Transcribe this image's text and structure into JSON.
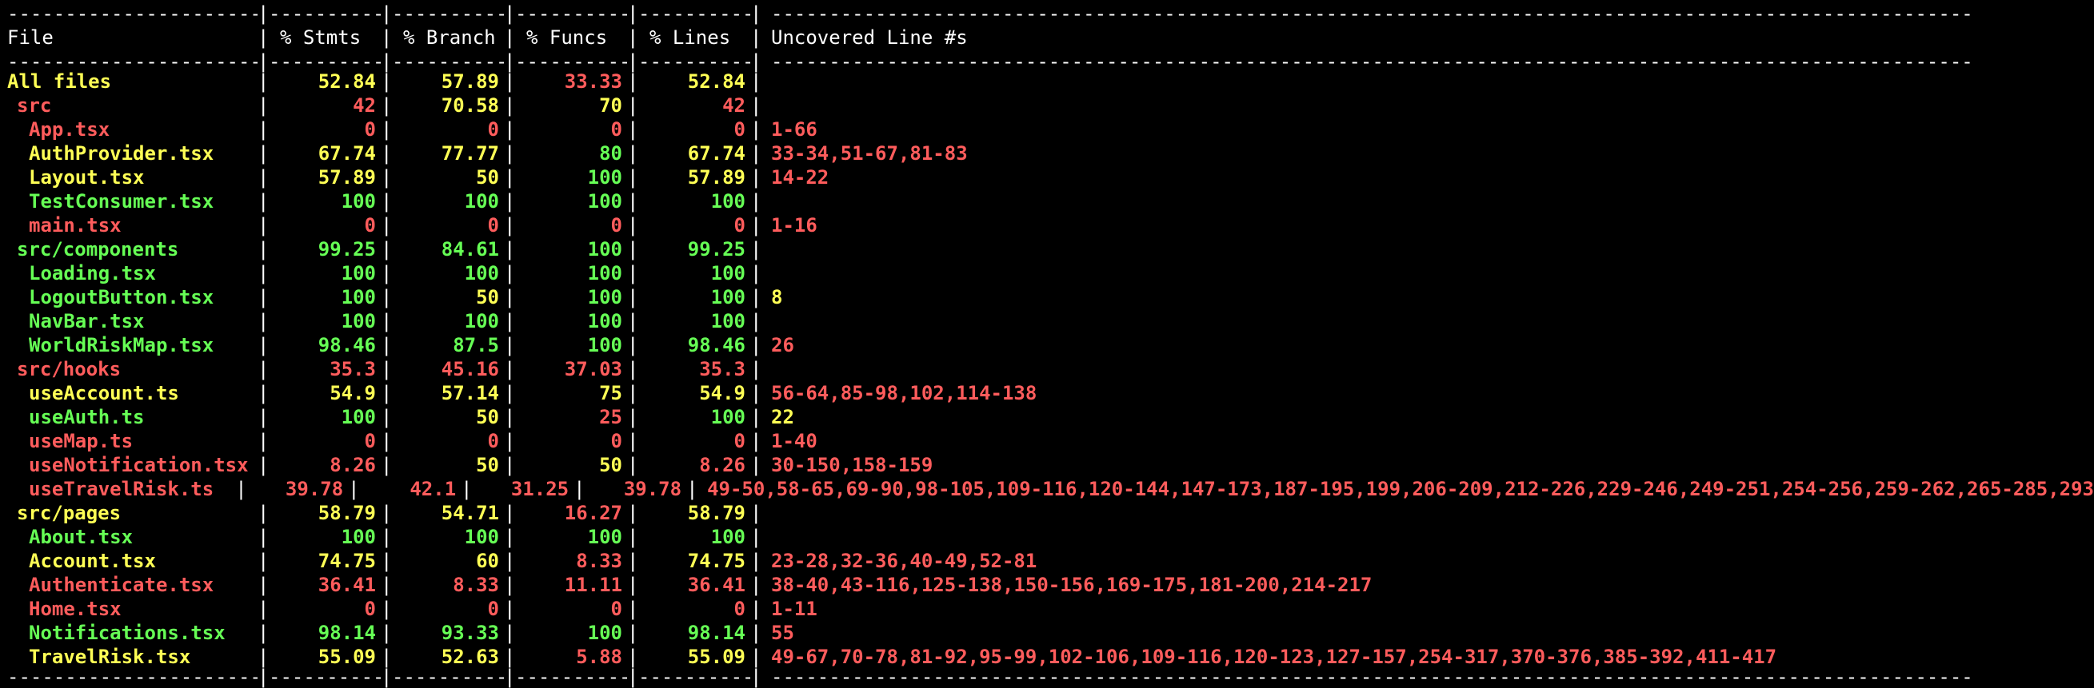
{
  "header": {
    "file": "File",
    "stmts": "% Stmts",
    "branch": "% Branch",
    "funcs": "% Funcs",
    "lines": "% Lines",
    "uncovered": "Uncovered Line #s"
  },
  "colors": {
    "high": "#66ff55",
    "medium": "#ffff55",
    "low": "#ff5c5c",
    "background": "#000000",
    "text": "#ffffff"
  },
  "rows": [
    {
      "file": "All files",
      "stmts": "52.84",
      "branch": "57.89",
      "funcs": "33.33",
      "lines": "52.84",
      "uncovered": "",
      "level": 0,
      "c": {
        "file": "medium",
        "stmts": "medium",
        "branch": "medium",
        "funcs": "low",
        "lines": "medium",
        "unc": "medium"
      }
    },
    {
      "file": "src",
      "stmts": "42",
      "branch": "70.58",
      "funcs": "70",
      "lines": "42",
      "uncovered": "",
      "level": 1,
      "c": {
        "file": "low",
        "stmts": "low",
        "branch": "medium",
        "funcs": "medium",
        "lines": "low",
        "unc": "low"
      }
    },
    {
      "file": "App.tsx",
      "stmts": "0",
      "branch": "0",
      "funcs": "0",
      "lines": "0",
      "uncovered": "1-66",
      "level": 2,
      "c": {
        "file": "low",
        "stmts": "low",
        "branch": "low",
        "funcs": "low",
        "lines": "low",
        "unc": "low"
      }
    },
    {
      "file": "AuthProvider.tsx",
      "stmts": "67.74",
      "branch": "77.77",
      "funcs": "80",
      "lines": "67.74",
      "uncovered": "33-34,51-67,81-83",
      "level": 2,
      "c": {
        "file": "medium",
        "stmts": "medium",
        "branch": "medium",
        "funcs": "good",
        "lines": "medium",
        "unc": "low"
      }
    },
    {
      "file": "Layout.tsx",
      "stmts": "57.89",
      "branch": "50",
      "funcs": "100",
      "lines": "57.89",
      "uncovered": "14-22",
      "level": 2,
      "c": {
        "file": "medium",
        "stmts": "medium",
        "branch": "medium",
        "funcs": "good",
        "lines": "medium",
        "unc": "low"
      }
    },
    {
      "file": "TestConsumer.tsx",
      "stmts": "100",
      "branch": "100",
      "funcs": "100",
      "lines": "100",
      "uncovered": "",
      "level": 2,
      "c": {
        "file": "good",
        "stmts": "good",
        "branch": "good",
        "funcs": "good",
        "lines": "good",
        "unc": "good"
      }
    },
    {
      "file": "main.tsx",
      "stmts": "0",
      "branch": "0",
      "funcs": "0",
      "lines": "0",
      "uncovered": "1-16",
      "level": 2,
      "c": {
        "file": "low",
        "stmts": "low",
        "branch": "low",
        "funcs": "low",
        "lines": "low",
        "unc": "low"
      }
    },
    {
      "file": "src/components",
      "stmts": "99.25",
      "branch": "84.61",
      "funcs": "100",
      "lines": "99.25",
      "uncovered": "",
      "level": 1,
      "c": {
        "file": "good",
        "stmts": "good",
        "branch": "good",
        "funcs": "good",
        "lines": "good",
        "unc": "good"
      }
    },
    {
      "file": "Loading.tsx",
      "stmts": "100",
      "branch": "100",
      "funcs": "100",
      "lines": "100",
      "uncovered": "",
      "level": 2,
      "c": {
        "file": "good",
        "stmts": "good",
        "branch": "good",
        "funcs": "good",
        "lines": "good",
        "unc": "good"
      }
    },
    {
      "file": "LogoutButton.tsx",
      "stmts": "100",
      "branch": "50",
      "funcs": "100",
      "lines": "100",
      "uncovered": "8",
      "level": 2,
      "c": {
        "file": "good",
        "stmts": "good",
        "branch": "medium",
        "funcs": "good",
        "lines": "good",
        "unc": "medium"
      }
    },
    {
      "file": "NavBar.tsx",
      "stmts": "100",
      "branch": "100",
      "funcs": "100",
      "lines": "100",
      "uncovered": "",
      "level": 2,
      "c": {
        "file": "good",
        "stmts": "good",
        "branch": "good",
        "funcs": "good",
        "lines": "good",
        "unc": "good"
      }
    },
    {
      "file": "WorldRiskMap.tsx",
      "stmts": "98.46",
      "branch": "87.5",
      "funcs": "100",
      "lines": "98.46",
      "uncovered": "26",
      "level": 2,
      "c": {
        "file": "good",
        "stmts": "good",
        "branch": "good",
        "funcs": "good",
        "lines": "good",
        "unc": "low"
      }
    },
    {
      "file": "src/hooks",
      "stmts": "35.3",
      "branch": "45.16",
      "funcs": "37.03",
      "lines": "35.3",
      "uncovered": "",
      "level": 1,
      "c": {
        "file": "low",
        "stmts": "low",
        "branch": "low",
        "funcs": "low",
        "lines": "low",
        "unc": "low"
      }
    },
    {
      "file": "useAccount.ts",
      "stmts": "54.9",
      "branch": "57.14",
      "funcs": "75",
      "lines": "54.9",
      "uncovered": "56-64,85-98,102,114-138",
      "level": 2,
      "c": {
        "file": "medium",
        "stmts": "medium",
        "branch": "medium",
        "funcs": "medium",
        "lines": "medium",
        "unc": "low"
      }
    },
    {
      "file": "useAuth.ts",
      "stmts": "100",
      "branch": "50",
      "funcs": "25",
      "lines": "100",
      "uncovered": "22",
      "level": 2,
      "c": {
        "file": "good",
        "stmts": "good",
        "branch": "medium",
        "funcs": "low",
        "lines": "good",
        "unc": "medium"
      }
    },
    {
      "file": "useMap.ts",
      "stmts": "0",
      "branch": "0",
      "funcs": "0",
      "lines": "0",
      "uncovered": "1-40",
      "level": 2,
      "c": {
        "file": "low",
        "stmts": "low",
        "branch": "low",
        "funcs": "low",
        "lines": "low",
        "unc": "low"
      }
    },
    {
      "file": "useNotification.tsx",
      "stmts": "8.26",
      "branch": "50",
      "funcs": "50",
      "lines": "8.26",
      "uncovered": "30-150,158-159",
      "level": 2,
      "c": {
        "file": "low",
        "stmts": "low",
        "branch": "medium",
        "funcs": "medium",
        "lines": "low",
        "unc": "low"
      }
    },
    {
      "file": "useTravelRisk.ts",
      "stmts": "39.78",
      "branch": "42.1",
      "funcs": "31.25",
      "lines": "39.78",
      "uncovered": "49-50,58-65,69-90,98-105,109-116,120-144,147-173,187-195,199,206-209,212-226,229-246,249-251,254-256,259-262,265-285,293",
      "level": 2,
      "c": {
        "file": "low",
        "stmts": "low",
        "branch": "low",
        "funcs": "low",
        "lines": "low",
        "unc": "low"
      }
    },
    {
      "file": "src/pages",
      "stmts": "58.79",
      "branch": "54.71",
      "funcs": "16.27",
      "lines": "58.79",
      "uncovered": "",
      "level": 1,
      "c": {
        "file": "medium",
        "stmts": "medium",
        "branch": "medium",
        "funcs": "low",
        "lines": "medium",
        "unc": "medium"
      }
    },
    {
      "file": "About.tsx",
      "stmts": "100",
      "branch": "100",
      "funcs": "100",
      "lines": "100",
      "uncovered": "",
      "level": 2,
      "c": {
        "file": "good",
        "stmts": "good",
        "branch": "good",
        "funcs": "good",
        "lines": "good",
        "unc": "good"
      }
    },
    {
      "file": "Account.tsx",
      "stmts": "74.75",
      "branch": "60",
      "funcs": "8.33",
      "lines": "74.75",
      "uncovered": "23-28,32-36,40-49,52-81",
      "level": 2,
      "c": {
        "file": "medium",
        "stmts": "medium",
        "branch": "medium",
        "funcs": "low",
        "lines": "medium",
        "unc": "low"
      }
    },
    {
      "file": "Authenticate.tsx",
      "stmts": "36.41",
      "branch": "8.33",
      "funcs": "11.11",
      "lines": "36.41",
      "uncovered": "38-40,43-116,125-138,150-156,169-175,181-200,214-217",
      "level": 2,
      "c": {
        "file": "low",
        "stmts": "low",
        "branch": "low",
        "funcs": "low",
        "lines": "low",
        "unc": "low"
      }
    },
    {
      "file": "Home.tsx",
      "stmts": "0",
      "branch": "0",
      "funcs": "0",
      "lines": "0",
      "uncovered": "1-11",
      "level": 2,
      "c": {
        "file": "low",
        "stmts": "low",
        "branch": "low",
        "funcs": "low",
        "lines": "low",
        "unc": "low"
      }
    },
    {
      "file": "Notifications.tsx",
      "stmts": "98.14",
      "branch": "93.33",
      "funcs": "100",
      "lines": "98.14",
      "uncovered": "55",
      "level": 2,
      "c": {
        "file": "good",
        "stmts": "good",
        "branch": "good",
        "funcs": "good",
        "lines": "good",
        "unc": "low"
      }
    },
    {
      "file": "TravelRisk.tsx",
      "stmts": "55.09",
      "branch": "52.63",
      "funcs": "5.88",
      "lines": "55.09",
      "uncovered": "49-67,70-78,81-92,95-99,102-106,109-116,120-123,127-157,254-317,370-376,385-392,411-417",
      "level": 2,
      "c": {
        "file": "medium",
        "stmts": "medium",
        "branch": "medium",
        "funcs": "low",
        "lines": "medium",
        "unc": "low"
      }
    }
  ]
}
